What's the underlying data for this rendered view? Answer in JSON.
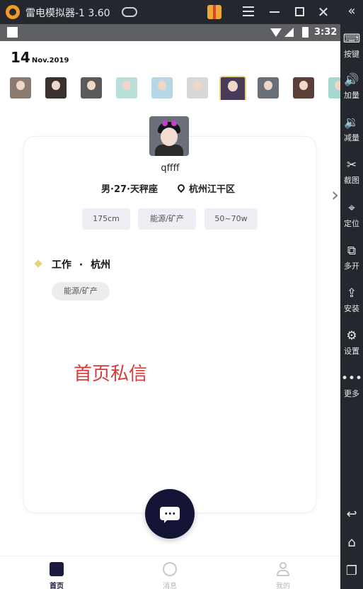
{
  "window": {
    "title": "雷电模拟器-1 3.60",
    "controls": [
      "menu-icon",
      "minimize-icon",
      "maximize-icon",
      "close-icon"
    ]
  },
  "sidebar": {
    "collapse_icon": "double-chevron-left-icon",
    "items": [
      {
        "icon": "keyboard-icon",
        "label": "按键"
      },
      {
        "icon": "volume-up-icon",
        "label": "加量"
      },
      {
        "icon": "volume-down-icon",
        "label": "减量"
      },
      {
        "icon": "scissors-icon",
        "label": "截图"
      },
      {
        "icon": "location-pin-icon",
        "label": "定位"
      },
      {
        "icon": "multi-window-icon",
        "label": "多开"
      },
      {
        "icon": "apk-install-icon",
        "label": "安装"
      },
      {
        "icon": "gear-icon",
        "label": "设置"
      },
      {
        "icon": "more-dots-icon",
        "label": "更多"
      }
    ],
    "nav": [
      "back-icon",
      "home-icon",
      "recent-apps-icon"
    ]
  },
  "status_bar": {
    "time": "3:32"
  },
  "date": {
    "day": "14",
    "month_year": "Nov.2019"
  },
  "avatars": {
    "count": 10,
    "selected_index": 6,
    "colors": [
      "#8a7a70",
      "#3a3030",
      "#5a5a5a",
      "#b8e0d8",
      "#b6d8e6",
      "#d8d8d8",
      "#4a3a5a",
      "#6a7078",
      "#5a4038",
      "#a8d8d0"
    ]
  },
  "profile": {
    "username": "qffff",
    "meta": "男·27·天秤座",
    "location": "杭州江干区",
    "tags": [
      "175cm",
      "能源/矿产",
      "50~70w"
    ]
  },
  "work": {
    "title": "工作 · 杭州",
    "tag": "能源/矿产"
  },
  "overlay_text": "首页私信",
  "tabs": [
    {
      "label": "首页",
      "icon": "home-card-icon",
      "active": true
    },
    {
      "label": "消息",
      "icon": "chat-icon",
      "active": false
    },
    {
      "label": "我的",
      "icon": "user-icon",
      "active": false
    }
  ],
  "colors": {
    "accent_dark": "#141536",
    "highlight_gold": "#e6d37a",
    "overlay_red": "#d93a3a"
  }
}
